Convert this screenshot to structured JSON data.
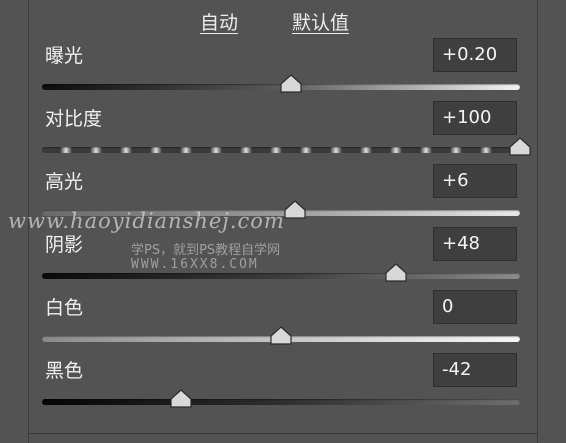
{
  "header": {
    "auto_label": "自动",
    "defaults_label": "默认值"
  },
  "sliders": [
    {
      "id": "exposure",
      "label": "曝光",
      "value": "+0.20",
      "numeric": 0.2,
      "min": -5,
      "max": 5
    },
    {
      "id": "contrast",
      "label": "对比度",
      "value": "+100",
      "numeric": 100,
      "min": -100,
      "max": 100
    },
    {
      "id": "highlights",
      "label": "高光",
      "value": "+6",
      "numeric": 6,
      "min": -100,
      "max": 100
    },
    {
      "id": "shadows",
      "label": "阴影",
      "value": "+48",
      "numeric": 48,
      "min": -100,
      "max": 100
    },
    {
      "id": "whites",
      "label": "白色",
      "value": "0",
      "numeric": 0,
      "min": -100,
      "max": 100
    },
    {
      "id": "blacks",
      "label": "黑色",
      "value": "-42",
      "numeric": -42,
      "min": -100,
      "max": 100
    }
  ],
  "watermark": {
    "line1": "www.haoyidianshej.com",
    "line2": "学PS，就到PS教程自学网",
    "line3": "WWW.16XX8.COM"
  },
  "colors": {
    "panel_bg": "#535353",
    "field_bg": "#3f3f3f",
    "thumb": "#d8d8d8",
    "text": "#f2f2f2"
  }
}
